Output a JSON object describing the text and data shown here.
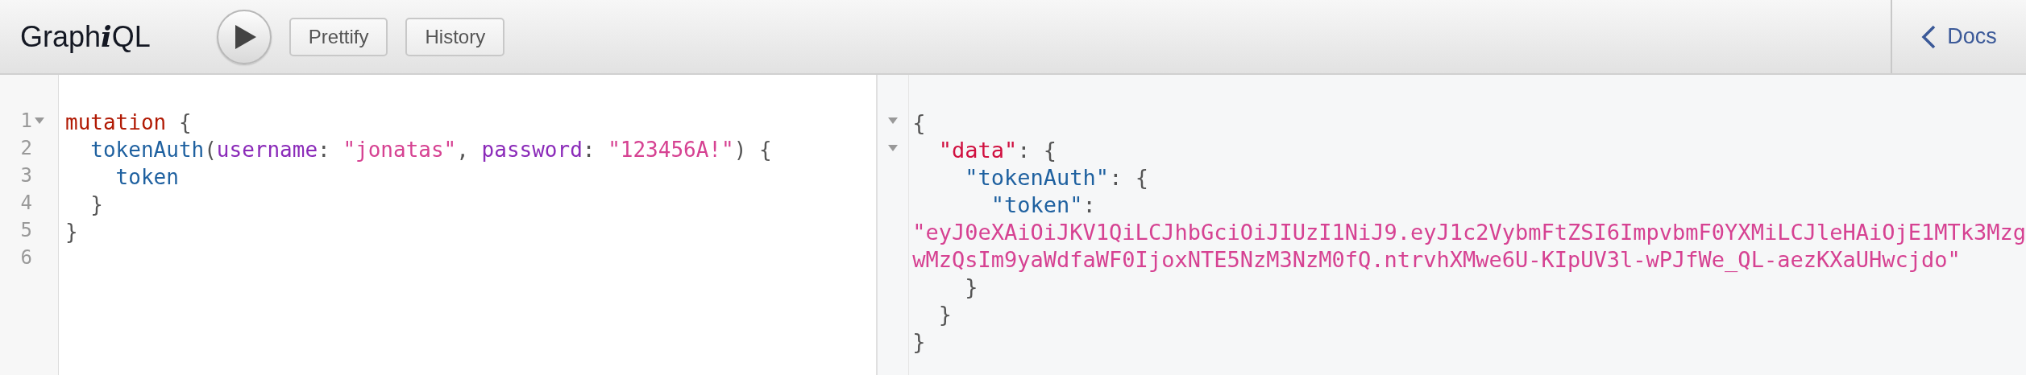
{
  "toolbar": {
    "title": [
      {
        "text": "Graph",
        "italic": false
      },
      {
        "text": "i",
        "italic": true
      },
      {
        "text": "QL",
        "italic": false
      }
    ],
    "buttons": [
      {
        "kind": "execute"
      },
      {
        "kind": "text",
        "label": "Prettify"
      },
      {
        "kind": "text",
        "label": "History"
      }
    ],
    "docs": {
      "label": "Docs"
    }
  },
  "query_editor": {
    "lines": [
      {
        "number": "1",
        "foldable": true,
        "tokens": [
          {
            "kind": "keyword",
            "text": "mutation"
          },
          {
            "kind": "punct",
            "text": " {"
          }
        ]
      },
      {
        "number": "2",
        "foldable": false,
        "tokens": [
          {
            "kind": "field",
            "text": "  tokenAuth"
          },
          {
            "kind": "punct",
            "text": "("
          },
          {
            "kind": "attr",
            "text": "username"
          },
          {
            "kind": "punct",
            "text": ": "
          },
          {
            "kind": "string",
            "text": "\"jonatas\""
          },
          {
            "kind": "punct",
            "text": ", "
          },
          {
            "kind": "attr",
            "text": "password"
          },
          {
            "kind": "punct",
            "text": ": "
          },
          {
            "kind": "string",
            "text": "\"123456A!\""
          },
          {
            "kind": "punct",
            "text": ") {"
          }
        ]
      },
      {
        "number": "3",
        "foldable": false,
        "tokens": [
          {
            "kind": "field",
            "text": "    token"
          }
        ]
      },
      {
        "number": "4",
        "foldable": false,
        "tokens": [
          {
            "kind": "punct",
            "text": "  }"
          }
        ]
      },
      {
        "number": "5",
        "foldable": false,
        "tokens": [
          {
            "kind": "punct",
            "text": "}"
          }
        ]
      },
      {
        "number": "6",
        "foldable": false
      }
    ]
  },
  "result_pane": {
    "lines": [
      {
        "foldable": true,
        "tokens": [
          {
            "kind": "punct",
            "text": "{"
          }
        ]
      },
      {
        "foldable": true,
        "tokens": [
          {
            "kind": "key",
            "text": "  \"data\""
          },
          {
            "kind": "punct",
            "text": ": {"
          }
        ]
      },
      {
        "foldable": false,
        "tokens": [
          {
            "kind": "field",
            "text": "    \"tokenAuth\""
          },
          {
            "kind": "punct",
            "text": ": {"
          }
        ]
      },
      {
        "foldable": false,
        "tokens": [
          {
            "kind": "field",
            "text": "      \"token\""
          },
          {
            "kind": "punct",
            "text": ":"
          }
        ]
      },
      {
        "foldable": false,
        "tokens": [
          {
            "kind": "string",
            "text": "\"eyJ0eXAiOiJKV1QiLCJhbGciOiJIUzI1NiJ9.eyJ1c2VybmFtZSI6ImpvbmF0YXMiLCJleHAiOjE1MTk3Mzg"
          }
        ]
      },
      {
        "foldable": false,
        "tokens": [
          {
            "kind": "string",
            "text": "wMzQsIm9yaWdfaWF0IjoxNTE5NzM3NzM0fQ.ntrvhXMwe6U-KIpUV3l-wPJfWe_QL-aezKXaUHwcjdo\""
          }
        ]
      },
      {
        "foldable": false,
        "tokens": [
          {
            "kind": "punct",
            "text": "    }"
          }
        ]
      },
      {
        "foldable": false,
        "tokens": [
          {
            "kind": "punct",
            "text": "  }"
          }
        ]
      },
      {
        "foldable": false,
        "tokens": [
          {
            "kind": "punct",
            "text": "}"
          }
        ]
      }
    ]
  }
}
